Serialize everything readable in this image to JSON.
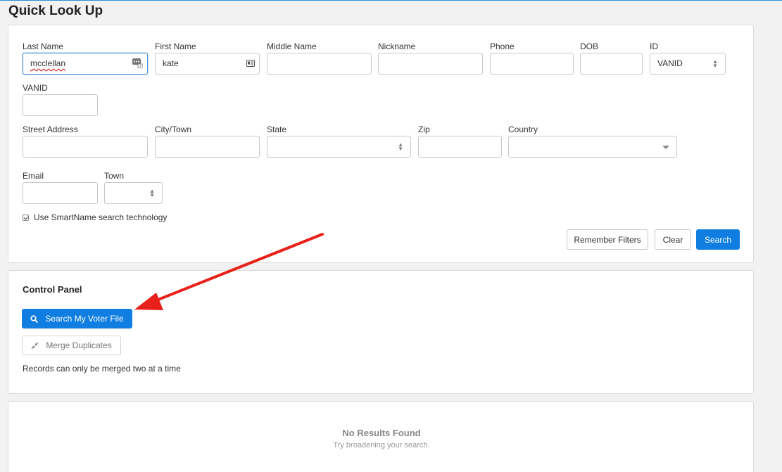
{
  "page": {
    "title": "Quick Look Up"
  },
  "lookup": {
    "last_name": {
      "label": "Last Name",
      "value": "mcclellan"
    },
    "first_name": {
      "label": "First Name",
      "value": "kate"
    },
    "middle_name": {
      "label": "Middle Name",
      "value": ""
    },
    "nickname": {
      "label": "Nickname",
      "value": ""
    },
    "phone": {
      "label": "Phone",
      "value": ""
    },
    "dob": {
      "label": "DOB",
      "value": ""
    },
    "id": {
      "label": "ID",
      "value": "VANID"
    },
    "vanid": {
      "label": "VANID",
      "value": ""
    },
    "street": {
      "label": "Street Address",
      "value": ""
    },
    "city": {
      "label": "City/Town",
      "value": ""
    },
    "state": {
      "label": "State",
      "value": ""
    },
    "zip": {
      "label": "Zip",
      "value": ""
    },
    "country": {
      "label": "Country",
      "value": ""
    },
    "email": {
      "label": "Email",
      "value": ""
    },
    "town": {
      "label": "Town",
      "value": ""
    },
    "smartname": {
      "label": "Use SmartName search technology",
      "checked": true
    },
    "buttons": {
      "remember": "Remember Filters",
      "clear": "Clear",
      "search": "Search"
    }
  },
  "control_panel": {
    "title": "Control Panel",
    "search_voter_file": "Search My Voter File",
    "merge_duplicates": "Merge Duplicates",
    "note": "Records can only be merged two at a time"
  },
  "results": {
    "title": "No Results Found",
    "subtitle": "Try broadening your search."
  },
  "colors": {
    "primary": "#0f7ee0",
    "annotation_arrow": "#e8201a"
  },
  "icons": [
    "contact-card-icon",
    "dots-badge-icon",
    "search-icon",
    "merge-icon",
    "chevron-updown-icon",
    "caret-down-icon",
    "checkmark-icon",
    "annotation-arrow"
  ]
}
